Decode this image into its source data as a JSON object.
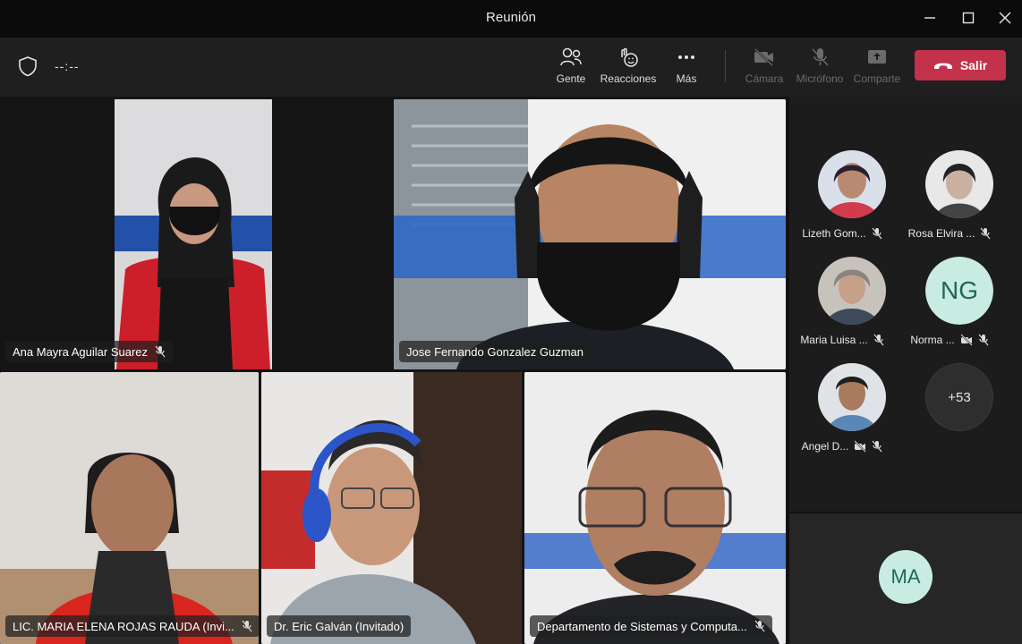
{
  "window": {
    "title": "Reunión"
  },
  "toolbar": {
    "timer": "--:--",
    "people_label": "Gente",
    "reactions_label": "Reacciones",
    "more_label": "Más",
    "camera_label": "Cámara",
    "mic_label": "Micrófono",
    "share_label": "Comparte",
    "leave_label": "Salir"
  },
  "stage": {
    "tiles": [
      {
        "name": "Ana Mayra Aguilar Suarez",
        "muted": true
      },
      {
        "name": "Jose Fernando Gonzalez Guzman",
        "muted": false
      },
      {
        "name": "LIC. MARIA ELENA ROJAS RAUDA (Invi...",
        "muted": true
      },
      {
        "name": "Dr. Eric Galván (Invitado)",
        "muted": false
      },
      {
        "name": "Departamento de Sistemas y Computa...",
        "muted": true
      }
    ]
  },
  "roster": {
    "participants": [
      {
        "name": "Lizeth Gom...",
        "muted": true
      },
      {
        "name": "Rosa Elvira ...",
        "muted": true
      },
      {
        "name": "Maria Luisa ...",
        "muted": true
      },
      {
        "name": "Norma ...",
        "initials": "NG",
        "muted": true
      },
      {
        "name": "Angel D...",
        "muted": true
      }
    ],
    "more_count": "+53"
  },
  "self_view": {
    "initials": "MA"
  },
  "colors": {
    "leave": "#c4314b",
    "selected_outline": "#8b8cc7",
    "avatar_bg": "#c9ece2"
  }
}
